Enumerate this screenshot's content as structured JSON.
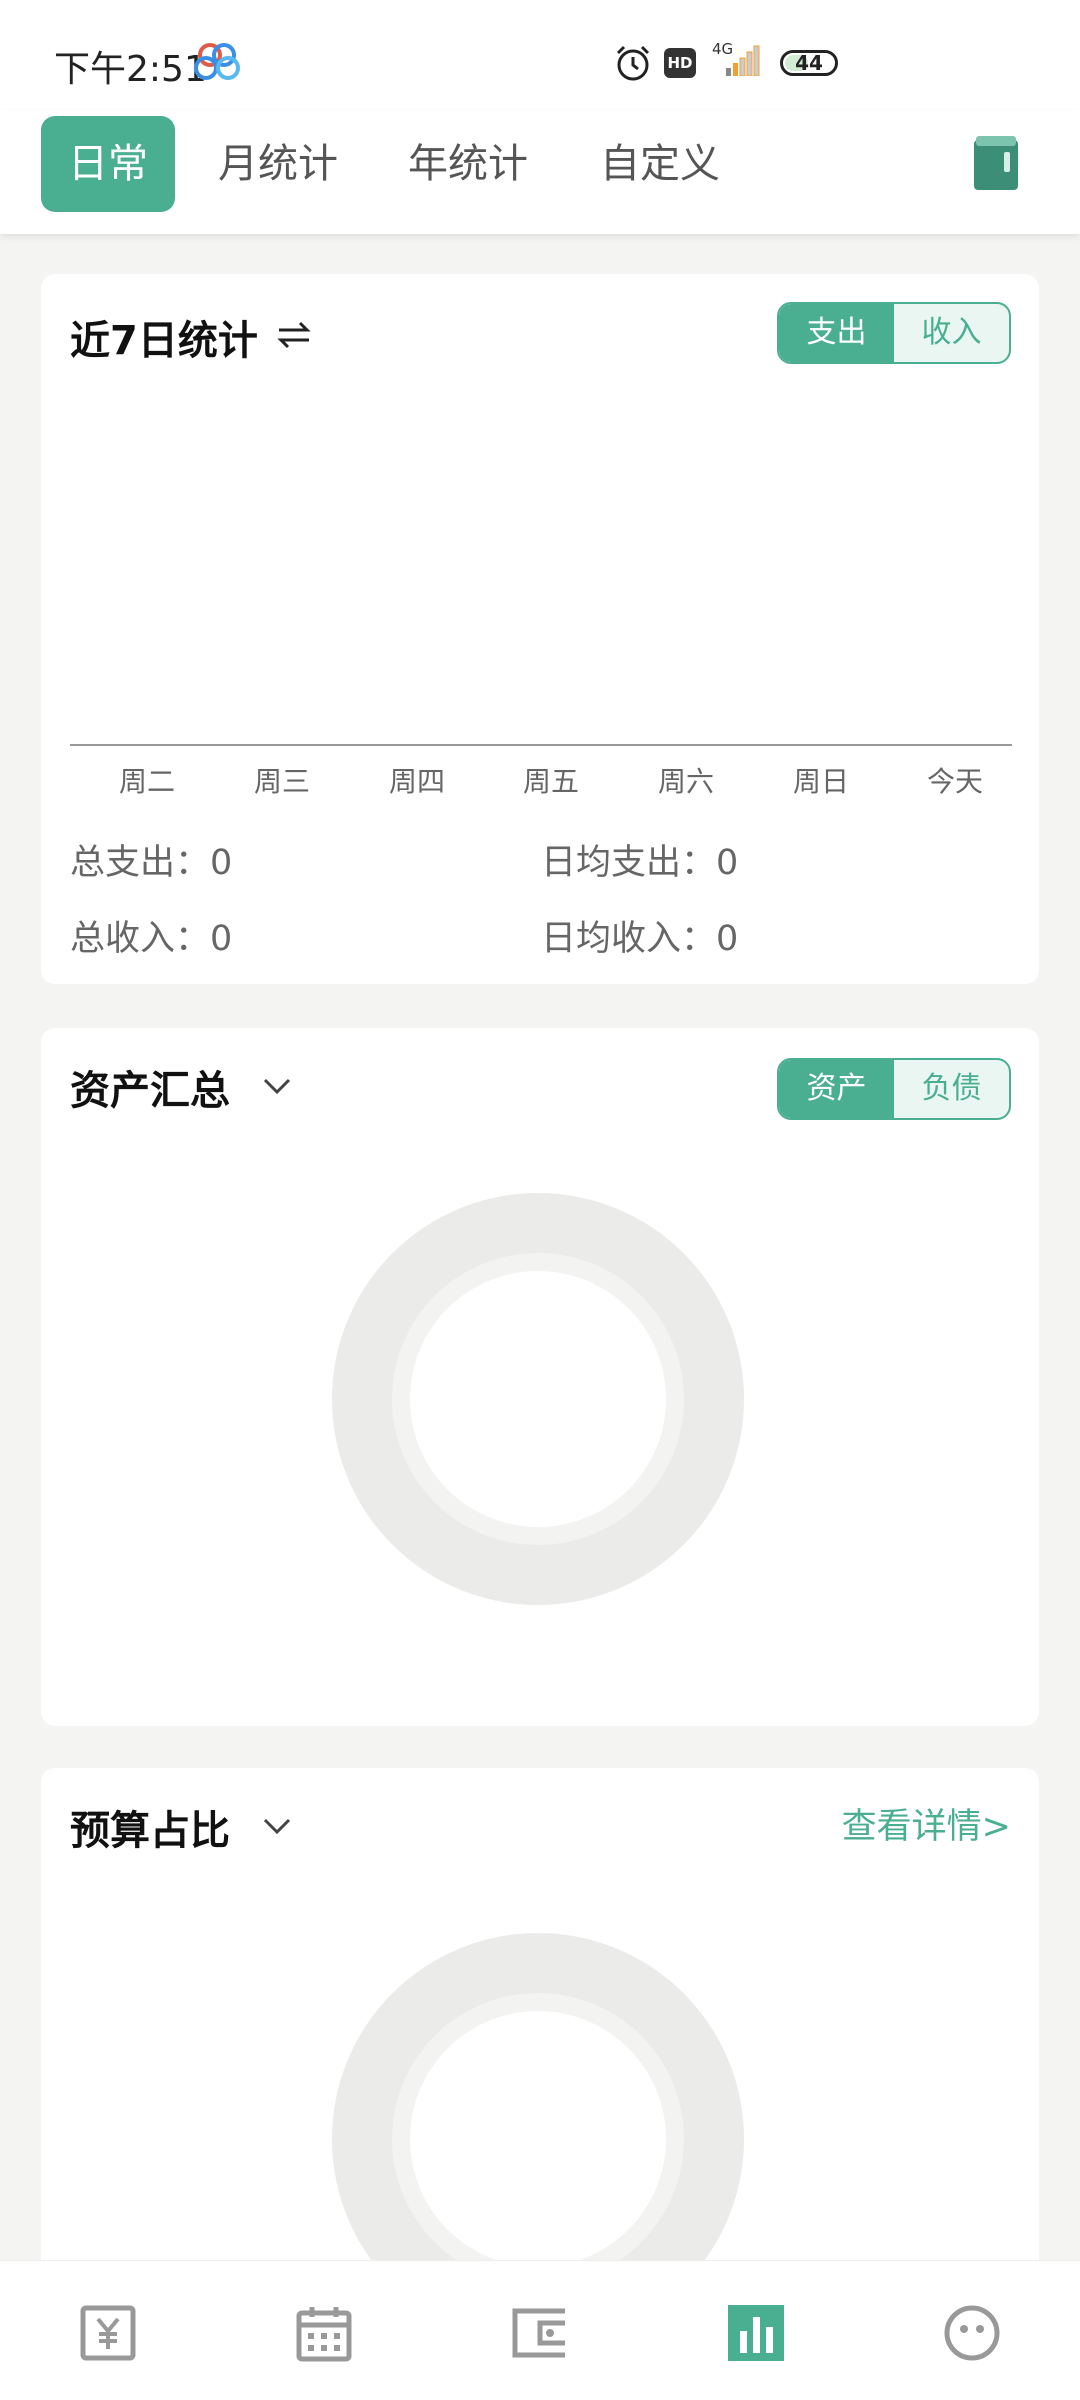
{
  "status_bar": {
    "time": "下午2:51",
    "battery": "44",
    "network": "4G",
    "hd": "HD",
    "icons": [
      "baidu-cloud-icon",
      "alarm-icon",
      "hd-icon",
      "signal-icon",
      "battery-icon"
    ]
  },
  "tabs": [
    {
      "label": "日常",
      "active": true
    },
    {
      "label": "月统计",
      "active": false
    },
    {
      "label": "年统计",
      "active": false
    },
    {
      "label": "自定义",
      "active": false
    }
  ],
  "weekly": {
    "title": "近7日统计",
    "toggle": [
      "支出",
      "收入"
    ],
    "days": [
      "周二",
      "周三",
      "周四",
      "周五",
      "周六",
      "周日",
      "今天"
    ],
    "total_expense_label": "总支出：0",
    "daily_expense_label": "日均支出：0",
    "total_income_label": "总收入：0",
    "daily_income_label": "日均收入：0"
  },
  "assets": {
    "title": "资产汇总",
    "toggle": [
      "资产",
      "负债"
    ]
  },
  "budget": {
    "title": "预算占比",
    "detail_link": "查看详情>"
  },
  "bottom_nav": [
    "yen-icon",
    "calendar-icon",
    "wallet-icon",
    "chart-icon",
    "profile-icon"
  ],
  "colors": {
    "accent": "#4aae91",
    "background": "#f4f4f2",
    "donut_ring": "#ebebea",
    "nav_inactive": "#999999"
  }
}
